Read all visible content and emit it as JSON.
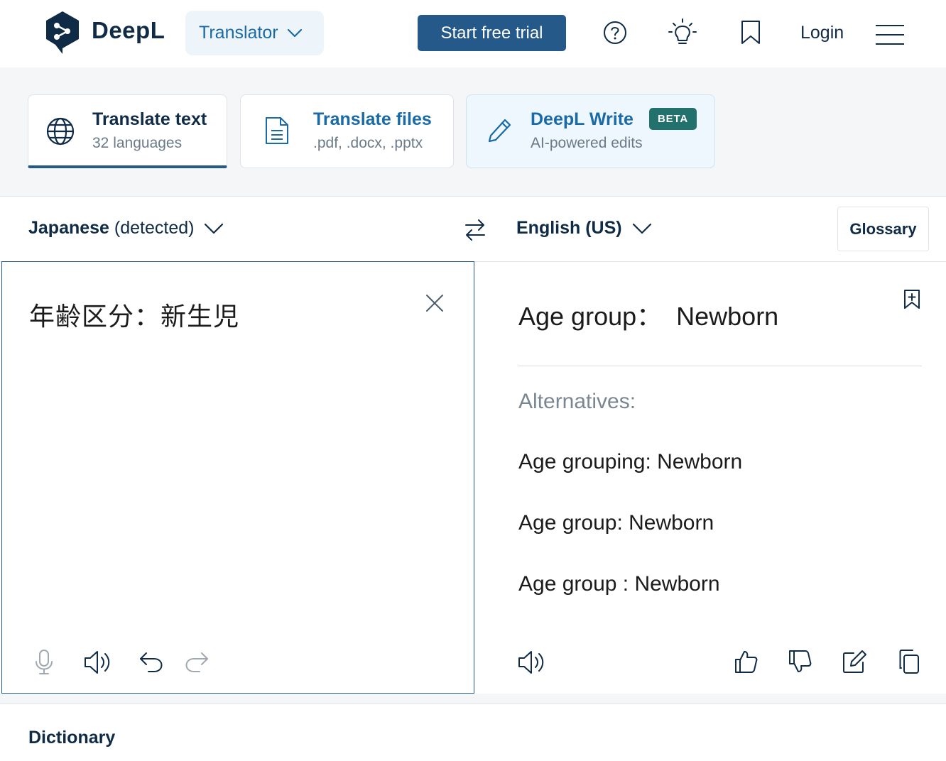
{
  "brand": {
    "name": "DeepL"
  },
  "nav": {
    "product_switch": "Translator",
    "trial_button": "Start free trial",
    "login": "Login",
    "icons": [
      "help-icon",
      "lightbulb-icon",
      "bookmark-icon",
      "hamburger-menu-icon"
    ]
  },
  "modes": [
    {
      "title": "Translate text",
      "subtitle": "32 languages",
      "icon": "globe-icon",
      "active": true
    },
    {
      "title": "Translate files",
      "subtitle": ".pdf, .docx, .pptx",
      "icon": "document-icon",
      "active": false
    },
    {
      "title": "DeepL Write",
      "subtitle": "AI-powered edits",
      "icon": "pencil-icon",
      "badge": "BETA",
      "active": false
    }
  ],
  "languages": {
    "source_name": "Japanese",
    "source_suffix": "(detected)",
    "target_name": "English (US)",
    "glossary": "Glossary"
  },
  "source": {
    "text": "年齢区分：新生児",
    "tools": [
      "microphone-icon",
      "speaker-icon",
      "undo-icon",
      "redo-icon"
    ]
  },
  "target": {
    "text": "Age group：  Newborn",
    "alternatives_label": "Alternatives:",
    "alternatives": [
      "Age grouping: Newborn",
      "Age group: Newborn",
      "Age group : Newborn"
    ],
    "tools": [
      "speaker-icon",
      "thumbs-up-icon",
      "thumbs-down-icon",
      "edit-icon",
      "copy-icon"
    ]
  },
  "dictionary": {
    "title": "Dictionary"
  },
  "colors": {
    "primary": "#24598a",
    "link": "#1a6aa5",
    "text": "#0f2b46",
    "beta_badge": "#22716c",
    "write_card_bg": "#eef7fd"
  }
}
